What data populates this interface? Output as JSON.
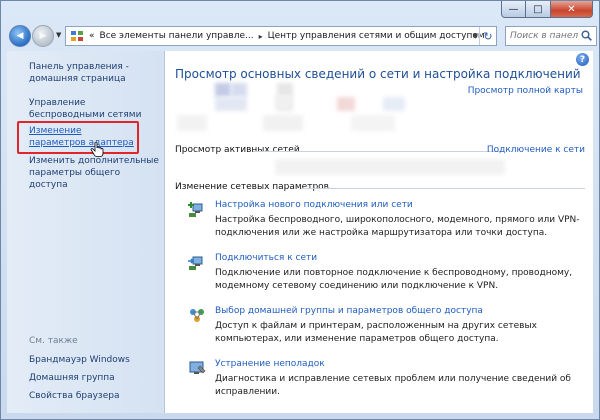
{
  "window": {
    "minimize": "—",
    "maximize": "□",
    "close": "✕"
  },
  "nav": {
    "back_icon": "arrow-left-icon",
    "forward_icon": "arrow-right-icon",
    "back_glyph": "◀",
    "forward_glyph": "▶",
    "dropdown_glyph": "▼",
    "refresh_glyph": "↻"
  },
  "address": {
    "overflow": "«",
    "segments": [
      "Все элементы панели управле...",
      "Центр управления сетями и общим доступом"
    ],
    "separator": "▸"
  },
  "search": {
    "placeholder": "Поиск в панели ..."
  },
  "sidebar": {
    "home": "Панель управления - домашняя страница",
    "wireless": "Управление беспроводными сетями",
    "adapter": "Изменение параметров адаптера",
    "sharing": "Изменить дополнительные параметры общего доступа",
    "see_also": "См. также",
    "see_also_items": [
      "Брандмауэр Windows",
      "Домашняя группа",
      "Свойства браузера"
    ]
  },
  "main": {
    "title": "Просмотр основных сведений о сети и настройка подключений",
    "full_map": "Просмотр полной карты",
    "active_networks": "Просмотр активных сетей",
    "connect": "Подключение к сети",
    "change_settings": "Изменение сетевых параметров",
    "help": "?",
    "tasks": [
      {
        "icon": "new-connection-icon",
        "link": "Настройка нового подключения или сети",
        "desc": "Настройка беспроводного, широкополосного, модемного, прямого или VPN-подключения или же настройка маршрутизатора или точки доступа."
      },
      {
        "icon": "connect-network-icon",
        "link": "Подключиться к сети",
        "desc": "Подключение или повторное подключение к беспроводному, проводному, модемному сетевому соединению или подключение к VPN."
      },
      {
        "icon": "homegroup-icon",
        "link": "Выбор домашней группы и параметров общего доступа",
        "desc": "Доступ к файлам и принтерам, расположенным на других сетевых компьютерах, или изменение параметров общего доступа."
      },
      {
        "icon": "troubleshoot-icon",
        "link": "Устранение неполадок",
        "desc": "Диагностика и исправление сетевых проблем или получение сведений об исправлении."
      }
    ]
  }
}
